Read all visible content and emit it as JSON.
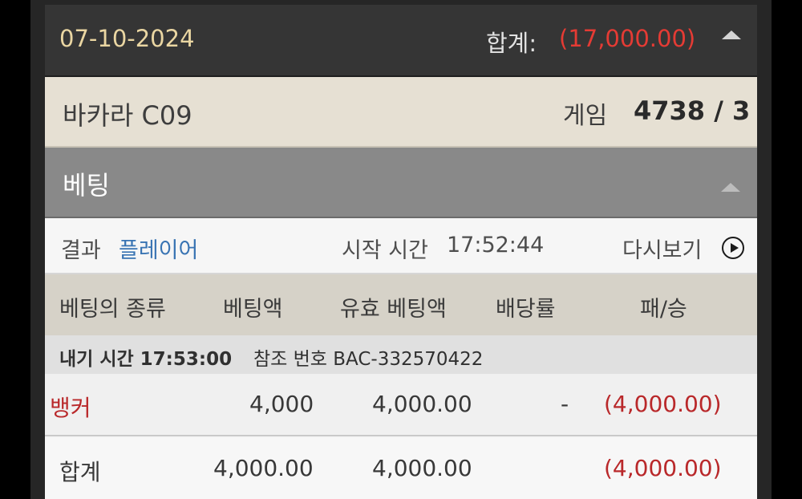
{
  "date_header": {
    "date": "07-10-2024",
    "total_label": "합계:",
    "total_value": "(17,000.00)"
  },
  "game_header": {
    "name": "바카라 C09",
    "game_label": "게임",
    "game_number": "4738 / 3"
  },
  "betting_header": {
    "title": "베팅"
  },
  "result_row": {
    "result_label": "결과",
    "result_value": "플레이어",
    "start_label": "시작 시간",
    "start_time": "17:52:44",
    "replay_label": "다시보기"
  },
  "columns": [
    "베팅의 종류",
    "베팅액",
    "유효 베팅액",
    "배당률",
    "패/승"
  ],
  "bet_info": {
    "bet_time_label": "내기 시간 17:53:00",
    "reference_label": "참조 번호 BAC-332570422"
  },
  "rows": [
    {
      "type": "뱅커",
      "amount": "4,000",
      "valid_amount": "4,000.00",
      "odds": "-",
      "result": "(4,000.00)"
    }
  ],
  "totals": {
    "label": "합계",
    "amount": "4,000.00",
    "valid_amount": "4,000.00",
    "result": "(4,000.00)"
  },
  "colors": {
    "negative": "#e53b34",
    "player_link": "#3974b3",
    "banker": "#b9282a",
    "date": "#ead6a2"
  },
  "icons": {
    "collapse": "caret-up-icon",
    "replay": "play-circle-icon"
  }
}
